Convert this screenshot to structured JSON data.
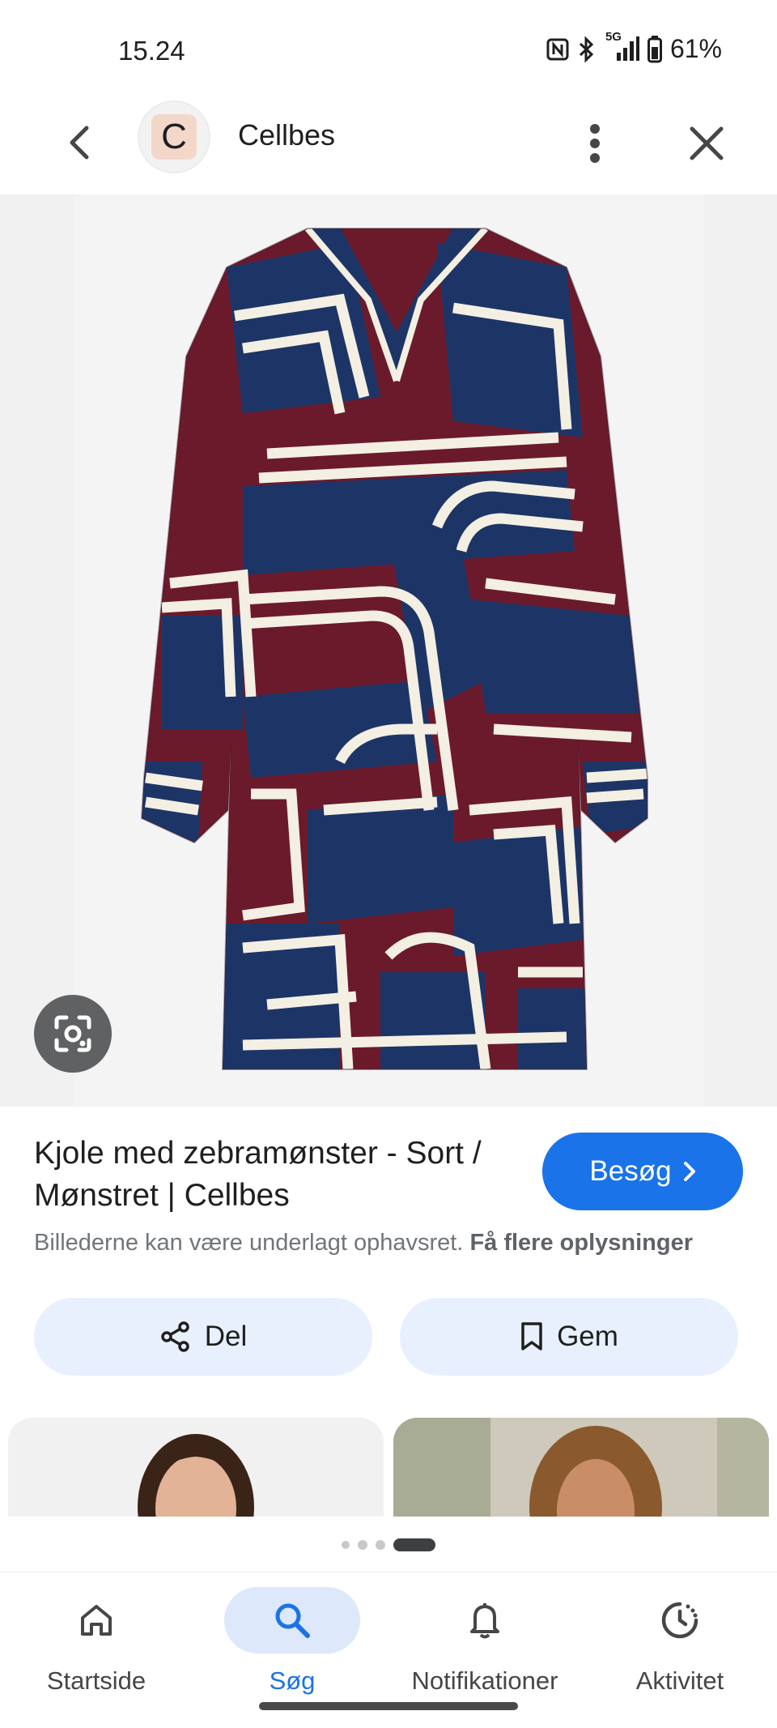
{
  "status_bar": {
    "time": "15.24",
    "network": "5G",
    "battery": "61%"
  },
  "header": {
    "avatar_letter": "C",
    "site_name": "Cellbes"
  },
  "result": {
    "title": "Kjole med zebramønster - Sort / Mønstret | Cellbes",
    "visit_label": "Besøg",
    "copyright_text": "Billederne kan være underlagt ophavsret.",
    "more_info_link": "Få flere oplysninger",
    "share_label": "Del",
    "save_label": "Gem"
  },
  "pager": {
    "pages": 4,
    "active_index": 3
  },
  "bottom_nav": {
    "items": [
      {
        "label": "Startside",
        "icon": "home-icon"
      },
      {
        "label": "Søg",
        "icon": "search-icon"
      },
      {
        "label": "Notifikationer",
        "icon": "bell-icon"
      },
      {
        "label": "Aktivitet",
        "icon": "activity-icon"
      }
    ],
    "active": "Søg"
  },
  "colors": {
    "accent": "#1a73e8",
    "chip_bg": "#e8f0fe",
    "dress_burgundy": "#6b1a2c",
    "dress_navy": "#1d3566",
    "dress_cream": "#f4efe3"
  }
}
